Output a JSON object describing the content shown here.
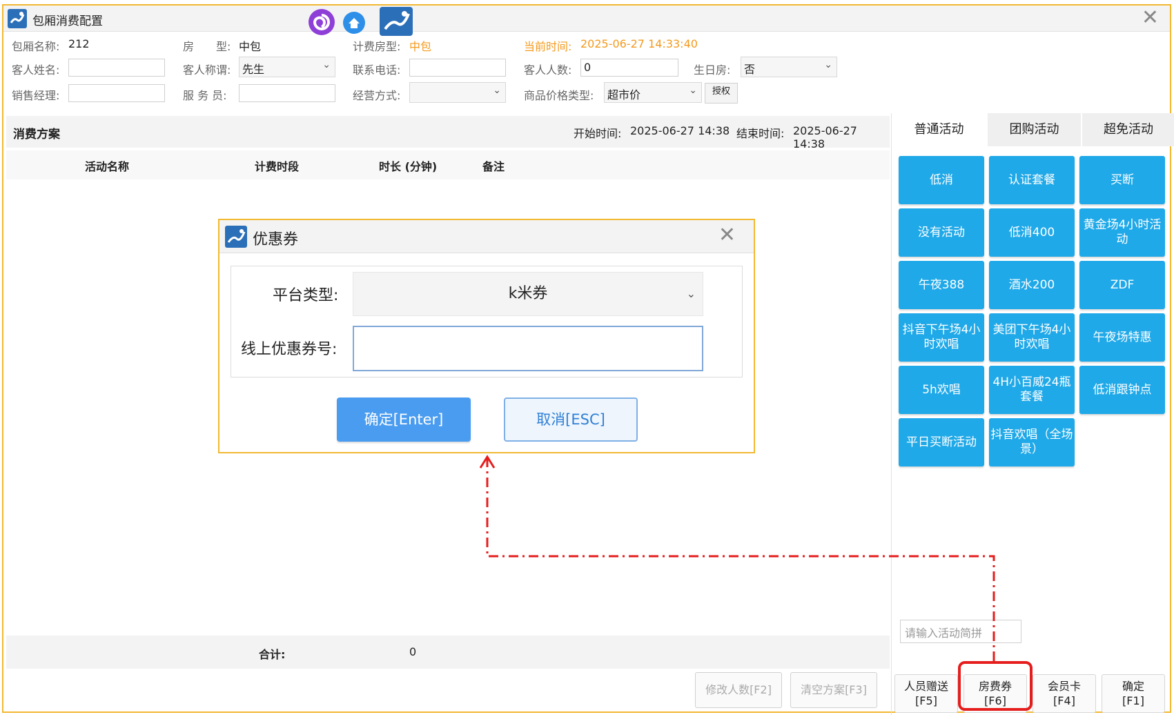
{
  "window": {
    "title": "包厢消费配置"
  },
  "header": {
    "room_name_label": "包厢名称:",
    "room_name": "212",
    "room_type_label": "房　　型:",
    "room_type": "中包",
    "billing_type_label": "计费房型:",
    "billing_type": "中包",
    "current_time_label": "当前时间:",
    "current_time": "2025-06-27 14:33:40",
    "guest_name_label": "客人姓名:",
    "guest_name": "",
    "guest_title_label": "客人称谓:",
    "guest_title": "先生",
    "phone_label": "联系电话:",
    "phone": "",
    "guest_count_label": "客人人数:",
    "guest_count": "0",
    "birthday_label": "生日房:",
    "birthday": "否",
    "sales_manager_label": "销售经理:",
    "sales_manager": "",
    "waiter_label": "服 务 员:",
    "waiter": "",
    "business_mode_label": "经营方式:",
    "business_mode": "",
    "price_type_label": "商品价格类型:",
    "price_type": "超市价",
    "authorize_label": "授权"
  },
  "plan": {
    "section_title": "消费方案",
    "start_label": "开始时间:",
    "start_time": "2025-06-27 14:38",
    "end_label": "结束时间:",
    "end_time": "2025-06-27 14:38",
    "columns": [
      "活动名称",
      "计费时段",
      "时长 (分钟)",
      "备注"
    ],
    "total_label": "合计:",
    "total_value": "0",
    "modify_count_button": "修改人数[F2]",
    "clear_plan_button": "清空方案[F3]"
  },
  "right_panel": {
    "tabs": [
      "普通活动",
      "团购活动",
      "超免活动"
    ],
    "activities": [
      "低消",
      "认证套餐",
      "买断",
      "没有活动",
      "低消400",
      "黄金场4小时活动",
      "午夜388",
      "酒水200",
      "ZDF",
      "抖音下午场4小时欢唱",
      "美团下午场4小时欢唱",
      "午夜场特惠",
      "5h欢唱",
      "4H小百威24瓶套餐",
      "低消跟钟点",
      "平日买断活动",
      "抖音欢唱（全场景）"
    ],
    "search_placeholder": "请输入活动简拼",
    "bottom_buttons": [
      {
        "line1": "人员赠送",
        "line2": "[F5]"
      },
      {
        "line1": "房费券",
        "line2": "[F6]"
      },
      {
        "line1": "会员卡",
        "line2": "[F4]"
      },
      {
        "line1": "确定",
        "line2": "[F1]"
      }
    ]
  },
  "dialog": {
    "title": "优惠券",
    "platform_label": "平台类型:",
    "platform_value": "k米券",
    "coupon_label": "线上优惠券号:",
    "coupon_value": "",
    "ok_button": "确定[Enter]",
    "cancel_button": "取消[ESC]"
  },
  "colors": {
    "accent_blue": "#20a9e8",
    "frame_yellow": "#f2b830",
    "annotation_red": "#e51d1d",
    "orange_text": "#f39a1e"
  }
}
